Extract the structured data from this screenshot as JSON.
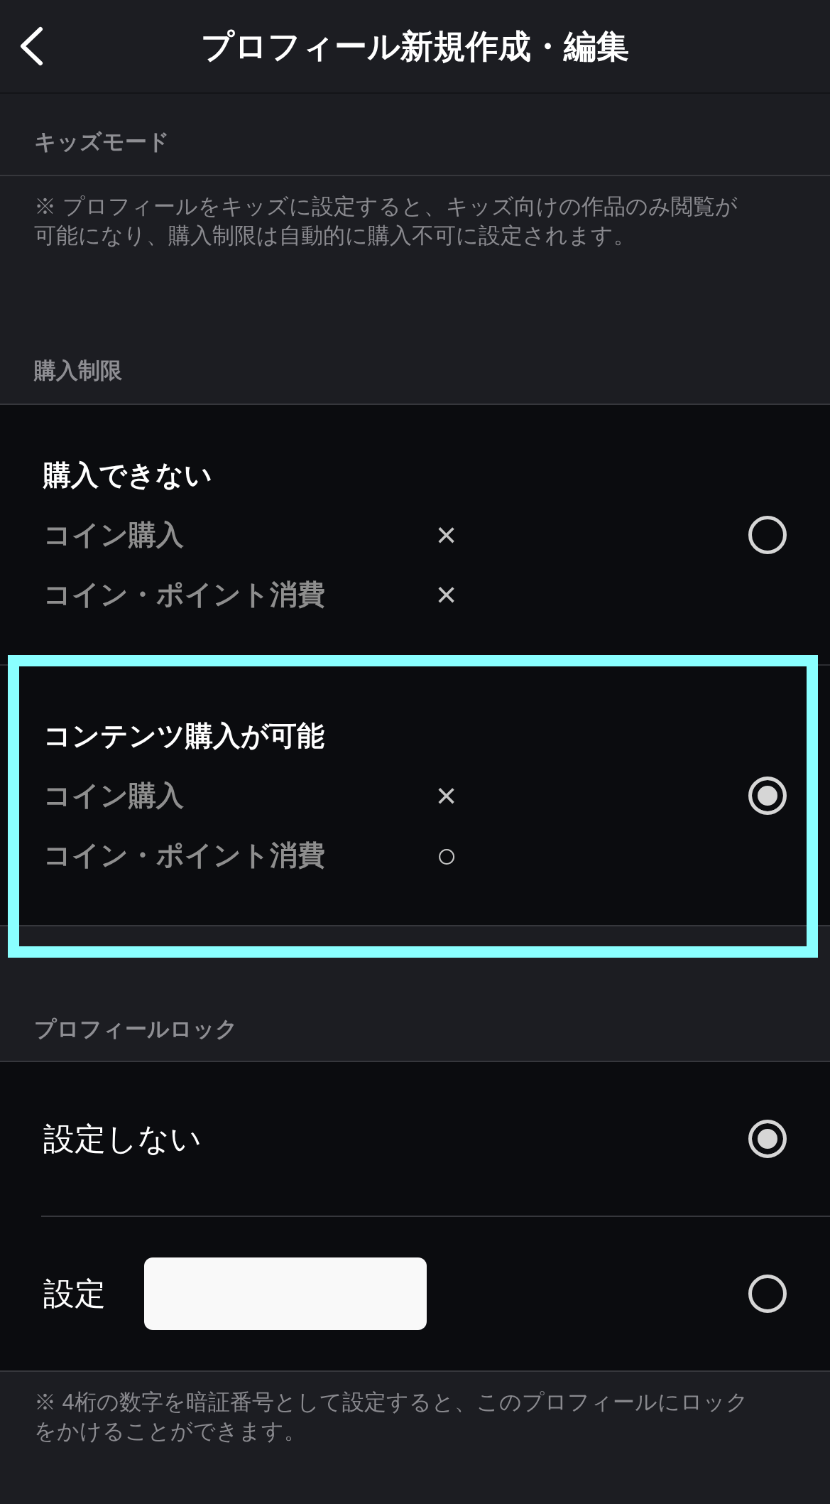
{
  "header": {
    "title": "プロフィール新規作成・編集"
  },
  "kids_mode": {
    "heading": "キッズモード",
    "note": "※ プロフィールをキッズに設定すると、キッズ向けの作品のみ閲覧が可能になり、購入制限は自動的に購入不可に設定されます。"
  },
  "purchase_limit": {
    "heading": "購入制限",
    "options": [
      {
        "title": "購入できない",
        "selected": false,
        "highlighted": false,
        "rows": [
          {
            "label": "コイン購入",
            "mark": "×"
          },
          {
            "label": "コイン・ポイント消費",
            "mark": "×"
          }
        ]
      },
      {
        "title": "コンテンツ購入が可能",
        "selected": true,
        "highlighted": true,
        "rows": [
          {
            "label": "コイン購入",
            "mark": "×"
          },
          {
            "label": "コイン・ポイント消費",
            "mark": "○"
          }
        ]
      }
    ]
  },
  "profile_lock": {
    "heading": "プロフィールロック",
    "options": [
      {
        "kind": "plain",
        "label": "設定しない",
        "selected": true
      },
      {
        "kind": "pin",
        "label": "設定",
        "selected": false
      }
    ],
    "note": "※ 4桁の数字を暗証番号として設定すると、このプロフィールにロックをかけることができます。"
  }
}
